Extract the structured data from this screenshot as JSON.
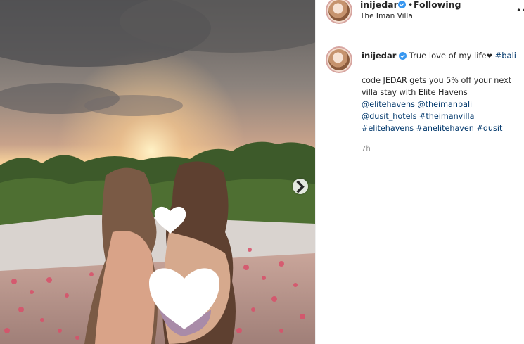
{
  "post": {
    "username": "inijedar",
    "follow_status": "Following",
    "separator": "•",
    "location": "The Iman Villa",
    "more_label": "••"
  },
  "caption": {
    "username": "inijedar",
    "text": "True love of my life",
    "emoji": "❤",
    "hashtag_inline": "#bali",
    "line_2": "code JEDAR gets you 5% off your next",
    "line_3": "villa stay with Elite Havens",
    "mentions_1": "@elitehavens @theimanbali",
    "mentions_2": "@dusit_hotels #theimanvilla",
    "tags_line": "#elitehavens #anelitehaven #dusit",
    "time": "7h"
  },
  "colors": {
    "verified": "#3897f0",
    "link": "#00376b",
    "muted": "#8e8e8e"
  },
  "icons": {
    "verified": "verified-badge-icon",
    "next": "chevron-right-icon"
  }
}
